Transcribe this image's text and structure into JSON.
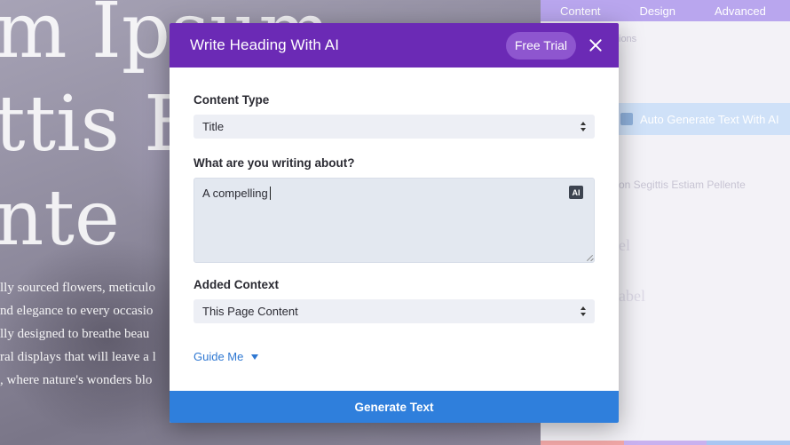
{
  "background": {
    "heading_lines": [
      "m Ipsum",
      "ttis E",
      "nte"
    ],
    "paragraph_lines": [
      "lly sourced flowers, meticulo",
      "nd elegance to every occasio",
      "lly designed to breathe beau",
      "ral displays that will leave a l",
      ", where nature's wonders blo"
    ]
  },
  "side_panel": {
    "tabs": [
      "Content",
      "Design",
      "Advanced"
    ],
    "sub_label": "ions",
    "auto_generate_label": "Auto Generate Text With AI",
    "label_1": "on Segittis Estiam Pellente",
    "label_2": "el",
    "label_3": "abel",
    "colors": {
      "tabs_bg": "#b9a6ee",
      "button_bg": "#cfe1f8"
    }
  },
  "modal": {
    "title": "Write Heading With AI",
    "free_trial_label": "Free Trial",
    "close_icon": "close-icon",
    "content_type": {
      "label": "Content Type",
      "value": "Title"
    },
    "topic": {
      "label": "What are you writing about?",
      "value": "A compelling",
      "ai_badge": "AI"
    },
    "added_context": {
      "label": "Added Context",
      "value": "This Page Content"
    },
    "guide_me_label": "Guide Me",
    "generate_label": "Generate Text",
    "colors": {
      "header": "#6b2ab5",
      "trial_pill": "#8e56cf",
      "primary_button": "#2f7fdc",
      "link": "#2f78d2"
    }
  }
}
